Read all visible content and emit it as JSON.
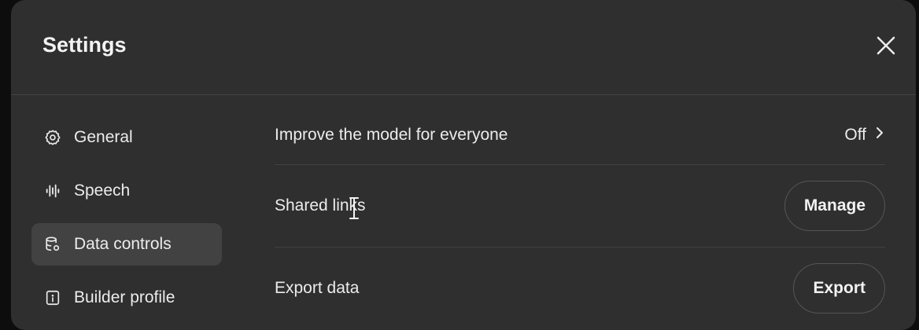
{
  "dialog": {
    "title": "Settings",
    "close_icon": "close-icon"
  },
  "sidebar": {
    "items": [
      {
        "label": "General",
        "icon": "gear-icon",
        "active": false
      },
      {
        "label": "Speech",
        "icon": "waveform-icon",
        "active": false
      },
      {
        "label": "Data controls",
        "icon": "database-icon",
        "active": true
      },
      {
        "label": "Builder profile",
        "icon": "profile-card-icon",
        "active": false
      }
    ]
  },
  "content": {
    "improve_model": {
      "label": "Improve the model for everyone",
      "value": "Off",
      "icon": "chevron-right-icon"
    },
    "shared_links": {
      "label": "Shared links",
      "button": "Manage"
    },
    "export_data": {
      "label": "Export data",
      "button": "Export"
    }
  },
  "colors": {
    "background": "#0d0d0d",
    "panel": "#2f2f2f",
    "active_item": "#424242",
    "divider": "#424242",
    "text": "#ececec"
  }
}
